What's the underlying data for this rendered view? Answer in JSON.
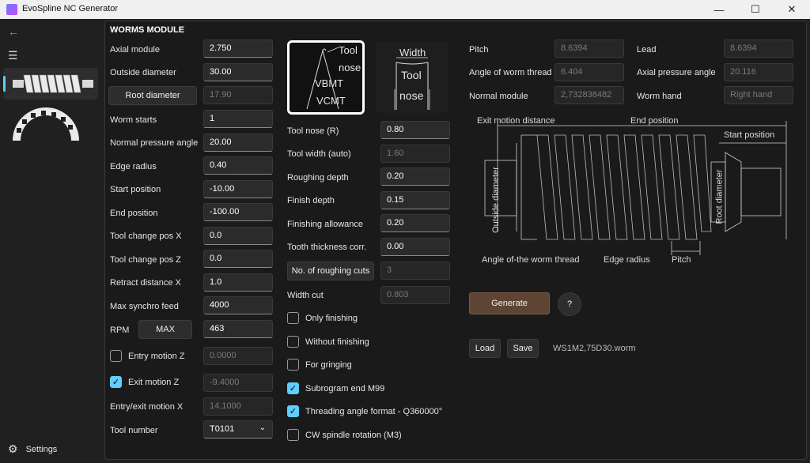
{
  "window": {
    "title": "EvoSpline NC Generator",
    "minimize": "—",
    "maximize": "☐",
    "close": "✕"
  },
  "sidebar": {
    "back_icon": "back-arrow-icon",
    "menu_icon": "hamburger-icon",
    "settings_label": "Settings"
  },
  "module_title": "WORMS MODULE",
  "left": [
    {
      "label": "Axial module",
      "value": "2.750"
    },
    {
      "label": "Outside diameter",
      "value": "30.00"
    },
    {
      "label": "Root diameter",
      "value": "17.90"
    },
    {
      "label": "Worm starts",
      "value": "1"
    },
    {
      "label": "Normal pressure angle",
      "value": "20.00"
    },
    {
      "label": "Edge radius",
      "value": "0.40"
    },
    {
      "label": "Start position",
      "value": "-10.00"
    },
    {
      "label": "End position",
      "value": "-100.00"
    },
    {
      "label": "Tool change pos X",
      "value": "0.0"
    },
    {
      "label": "Tool change pos Z",
      "value": "0.0"
    },
    {
      "label": "Retract distance X",
      "value": "1.0"
    },
    {
      "label": "Max synchro feed",
      "value": "4000"
    },
    {
      "label": "RPM",
      "value": "463"
    }
  ],
  "rpm_max_label": "MAX",
  "entry_motion": {
    "label": "Entry motion Z",
    "value": "0.0000",
    "checked": false
  },
  "exit_motion": {
    "label": "Exit motion Z",
    "value": "-9.4000",
    "checked": true
  },
  "entry_exit": {
    "label": "Entry/exit motion X",
    "value": "14.1000"
  },
  "tool_number": {
    "label": "Tool number",
    "value": "T0101"
  },
  "tool_img1": {
    "t1": "Tool",
    "t2": "nose",
    "t3": "VBMT",
    "t4": "VCMT"
  },
  "tool_img2": {
    "t1": "Width",
    "t2": "Tool",
    "t3": "nose"
  },
  "middle": [
    {
      "label": "Tool nose (R)",
      "value": "0.80"
    },
    {
      "label": "Tool width (auto)",
      "value": "1.60"
    },
    {
      "label": "Roughing depth",
      "value": "0.20"
    },
    {
      "label": "Finish depth",
      "value": "0.15"
    },
    {
      "label": "Finishing allowance",
      "value": "0.20"
    },
    {
      "label": "Tooth thickness corr.",
      "value": "0.00"
    },
    {
      "label": "No. of roughing cuts",
      "value": "3"
    },
    {
      "label": "Width cut",
      "value": "0.803"
    }
  ],
  "checks": [
    {
      "label": "Only finishing",
      "checked": false
    },
    {
      "label": "Without finishing",
      "checked": false
    },
    {
      "label": "For gringing",
      "checked": false
    },
    {
      "label": "Subrogram end M99",
      "checked": true
    },
    {
      "label": "Threading angle format - Q360000°",
      "checked": true
    },
    {
      "label": "CW spindle rotation (M3)",
      "checked": false
    }
  ],
  "results": [
    {
      "label": "Pitch",
      "value": "8.6394"
    },
    {
      "label": "Lead",
      "value": "8.6394"
    },
    {
      "label": "Angle of worm thread",
      "value": "6.404"
    },
    {
      "label": "Axial pressure angle",
      "value": "20.116"
    },
    {
      "label": "Normal module",
      "value": "2,732838482"
    },
    {
      "label": "Worm hand",
      "value": "Right hand"
    }
  ],
  "diagram": {
    "exit_motion": "Exit motion distance",
    "end_position": "End position",
    "start_position": "Start position",
    "outside_diameter": "Outside diameter",
    "root_diameter": "Root diameter",
    "angle_thread": "Angle of-the worm thread",
    "edge_radius": "Edge radius",
    "pitch": "Pitch"
  },
  "actions": {
    "generate": "Generate",
    "help": "?",
    "load": "Load",
    "save": "Save",
    "filename": "WS1M2,75D30.worm"
  }
}
